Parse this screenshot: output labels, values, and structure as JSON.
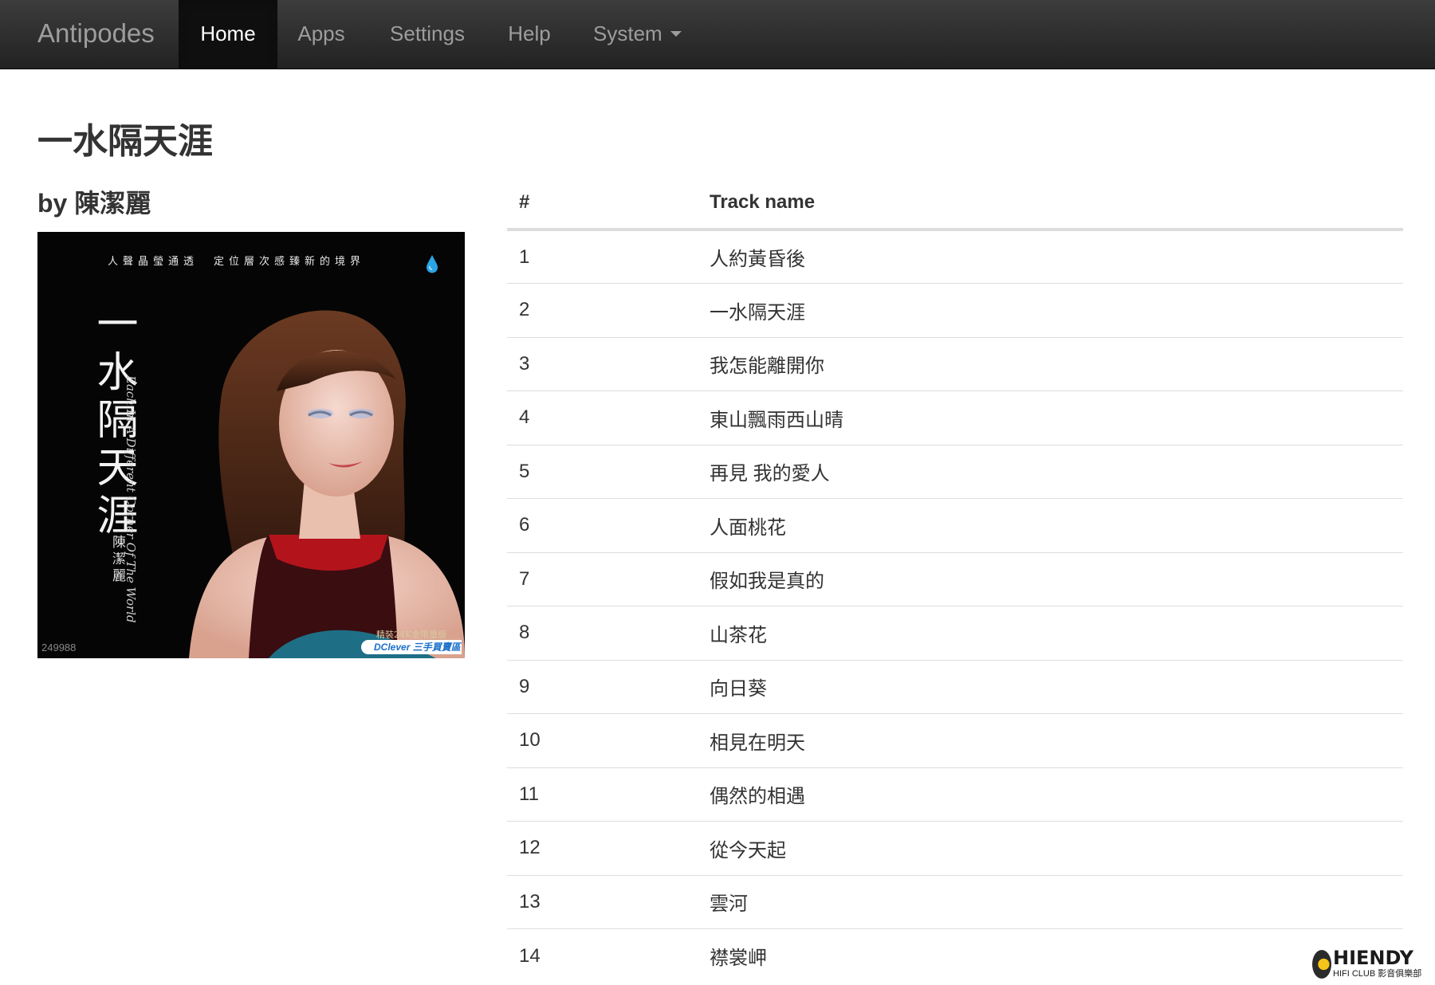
{
  "navbar": {
    "brand": "Antipodes",
    "items": [
      {
        "label": "Home",
        "active": true
      },
      {
        "label": "Apps",
        "active": false
      },
      {
        "label": "Settings",
        "active": false
      },
      {
        "label": "Help",
        "active": false
      },
      {
        "label": "System",
        "active": false,
        "dropdown": true
      }
    ]
  },
  "album": {
    "title": "一水隔天涯",
    "artist_line": "by 陳潔麗",
    "cover": {
      "slogan": "人聲晶瑩通透　定位層次感臻新的境界",
      "title_vertical": "一水隔天涯",
      "subtitle_vertical": "Each In A Different Corner Of The World",
      "artist_vertical": "陳潔麗",
      "badge": "精裝24K金限量版",
      "logo": "DClever 三手買賣區",
      "code": "249988"
    }
  },
  "tracks": {
    "headers": {
      "number": "#",
      "name": "Track name"
    },
    "rows": [
      {
        "number": "1",
        "name": "人約黃昏後"
      },
      {
        "number": "2",
        "name": "一水隔天涯"
      },
      {
        "number": "3",
        "name": "我怎能離開你"
      },
      {
        "number": "4",
        "name": "東山飄雨西山晴"
      },
      {
        "number": "5",
        "name": "再見 我的愛人"
      },
      {
        "number": "6",
        "name": "人面桃花"
      },
      {
        "number": "7",
        "name": "假如我是真的"
      },
      {
        "number": "8",
        "name": "山茶花"
      },
      {
        "number": "9",
        "name": "向日葵"
      },
      {
        "number": "10",
        "name": "相見在明天"
      },
      {
        "number": "11",
        "name": "偶然的相遇"
      },
      {
        "number": "12",
        "name": "從今天起"
      },
      {
        "number": "13",
        "name": "雲河"
      },
      {
        "number": "14",
        "name": "襟裳岬"
      }
    ]
  },
  "watermark": {
    "name": "HIENDY",
    "subtitle": "HIFI CLUB 影音俱樂部"
  },
  "colors": {
    "navbar_bg": "#222222",
    "nav_text": "#9d9d9d",
    "nav_active_text": "#ffffff",
    "text": "#333333",
    "table_border": "#dddddd"
  }
}
